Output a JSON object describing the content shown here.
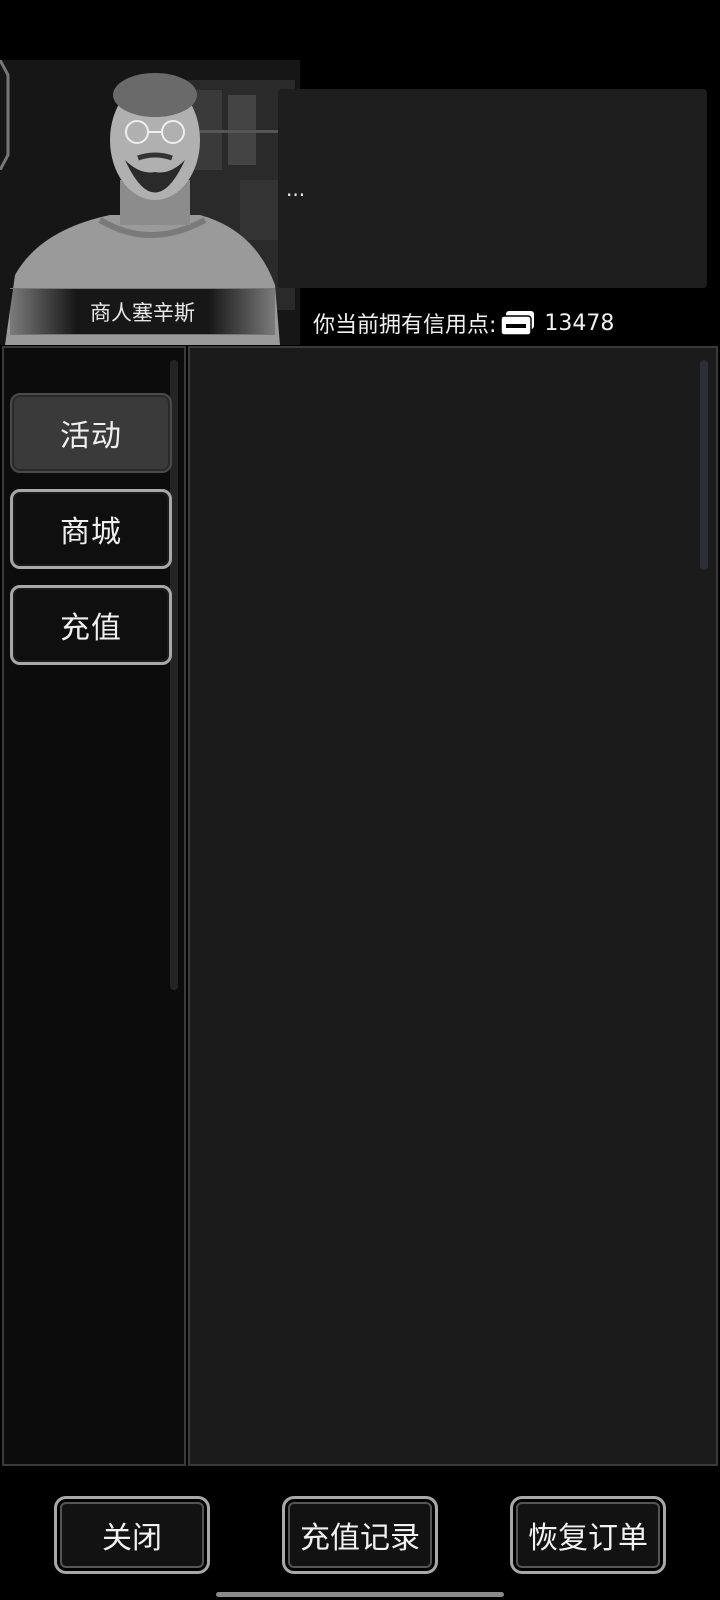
{
  "npc": {
    "name": "商人塞辛斯",
    "dialog": "..."
  },
  "credits": {
    "label": "你当前拥有信用点:",
    "icon": "credit-card-icon",
    "value": "13478"
  },
  "tabs": [
    {
      "label": "活动",
      "active": true
    },
    {
      "label": "商城",
      "active": false
    },
    {
      "label": "充值",
      "active": false
    }
  ],
  "footer": {
    "close_label": "关闭",
    "history_label": "充值记录",
    "restore_label": "恢复订单"
  }
}
